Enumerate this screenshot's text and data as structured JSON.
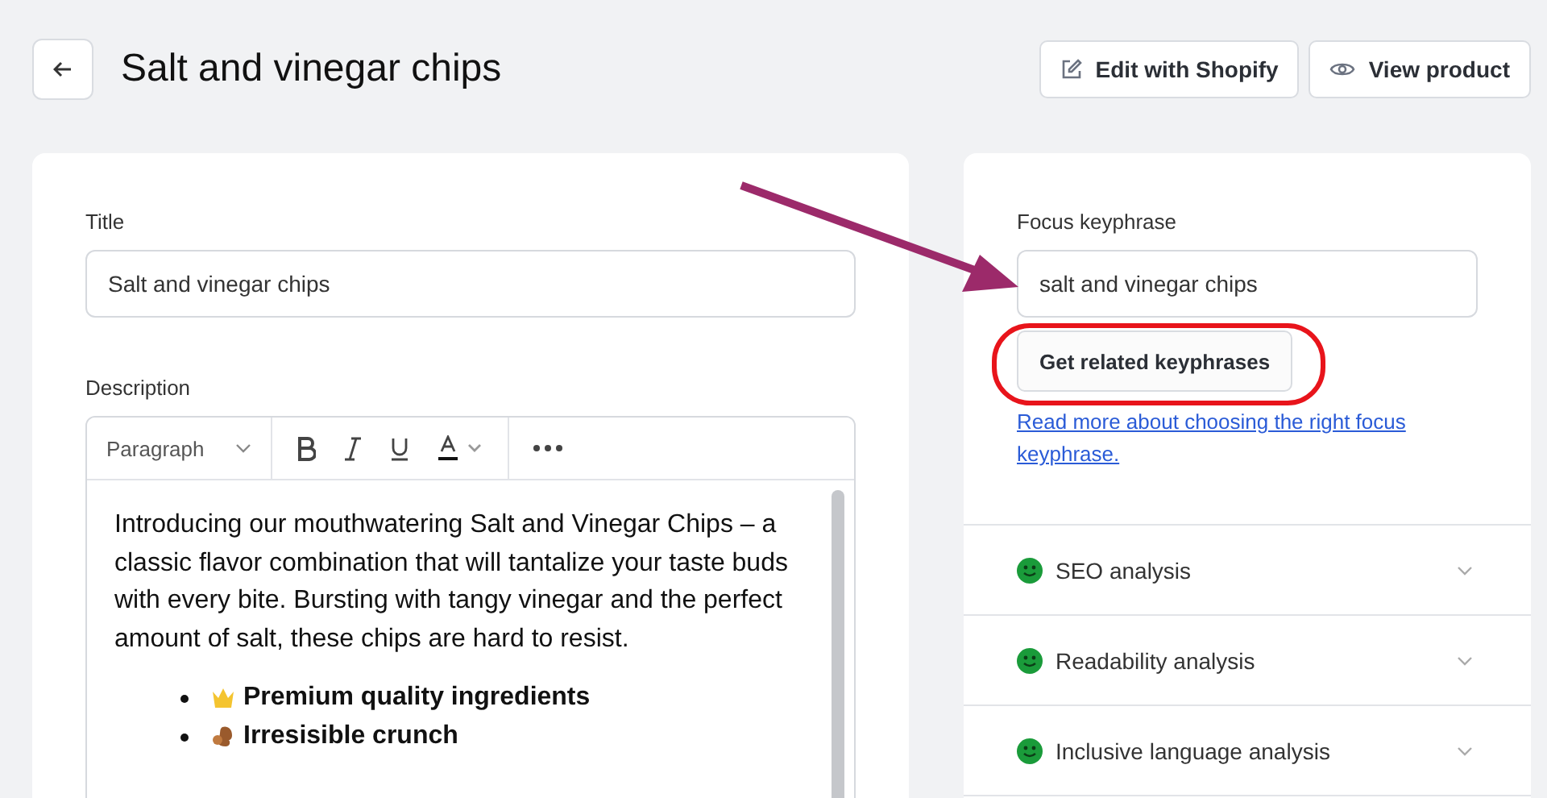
{
  "header": {
    "title": "Salt and vinegar chips",
    "buttons": [
      {
        "kind": "edit",
        "label": "Edit with Shopify"
      },
      {
        "kind": "view",
        "label": "View product"
      }
    ]
  },
  "product": {
    "title_label": "Title",
    "title_value": "Salt and vinegar chips",
    "description_label": "Description",
    "format": "Paragraph",
    "body": "Introducing our mouthwatering Salt and Vinegar Chips – a classic flavor combination that will tantalize your taste buds with every bite. Bursting with tangy vinegar and the perfect amount of salt, these chips are hard to resist.",
    "bullets": [
      "Premium quality ingredients",
      "Irresisible crunch"
    ]
  },
  "seo": {
    "keyphrase_label": "Focus keyphrase",
    "keyphrase_value": "salt and vinegar chips",
    "related_button": "Get related keyphrases",
    "link": "Read more about choosing the right focus keyphrase.",
    "analyses": [
      {
        "label": "SEO analysis",
        "expanded": false
      },
      {
        "label": "Readability analysis",
        "expanded": false
      },
      {
        "label": "Inclusive language analysis",
        "expanded": false
      }
    ]
  }
}
